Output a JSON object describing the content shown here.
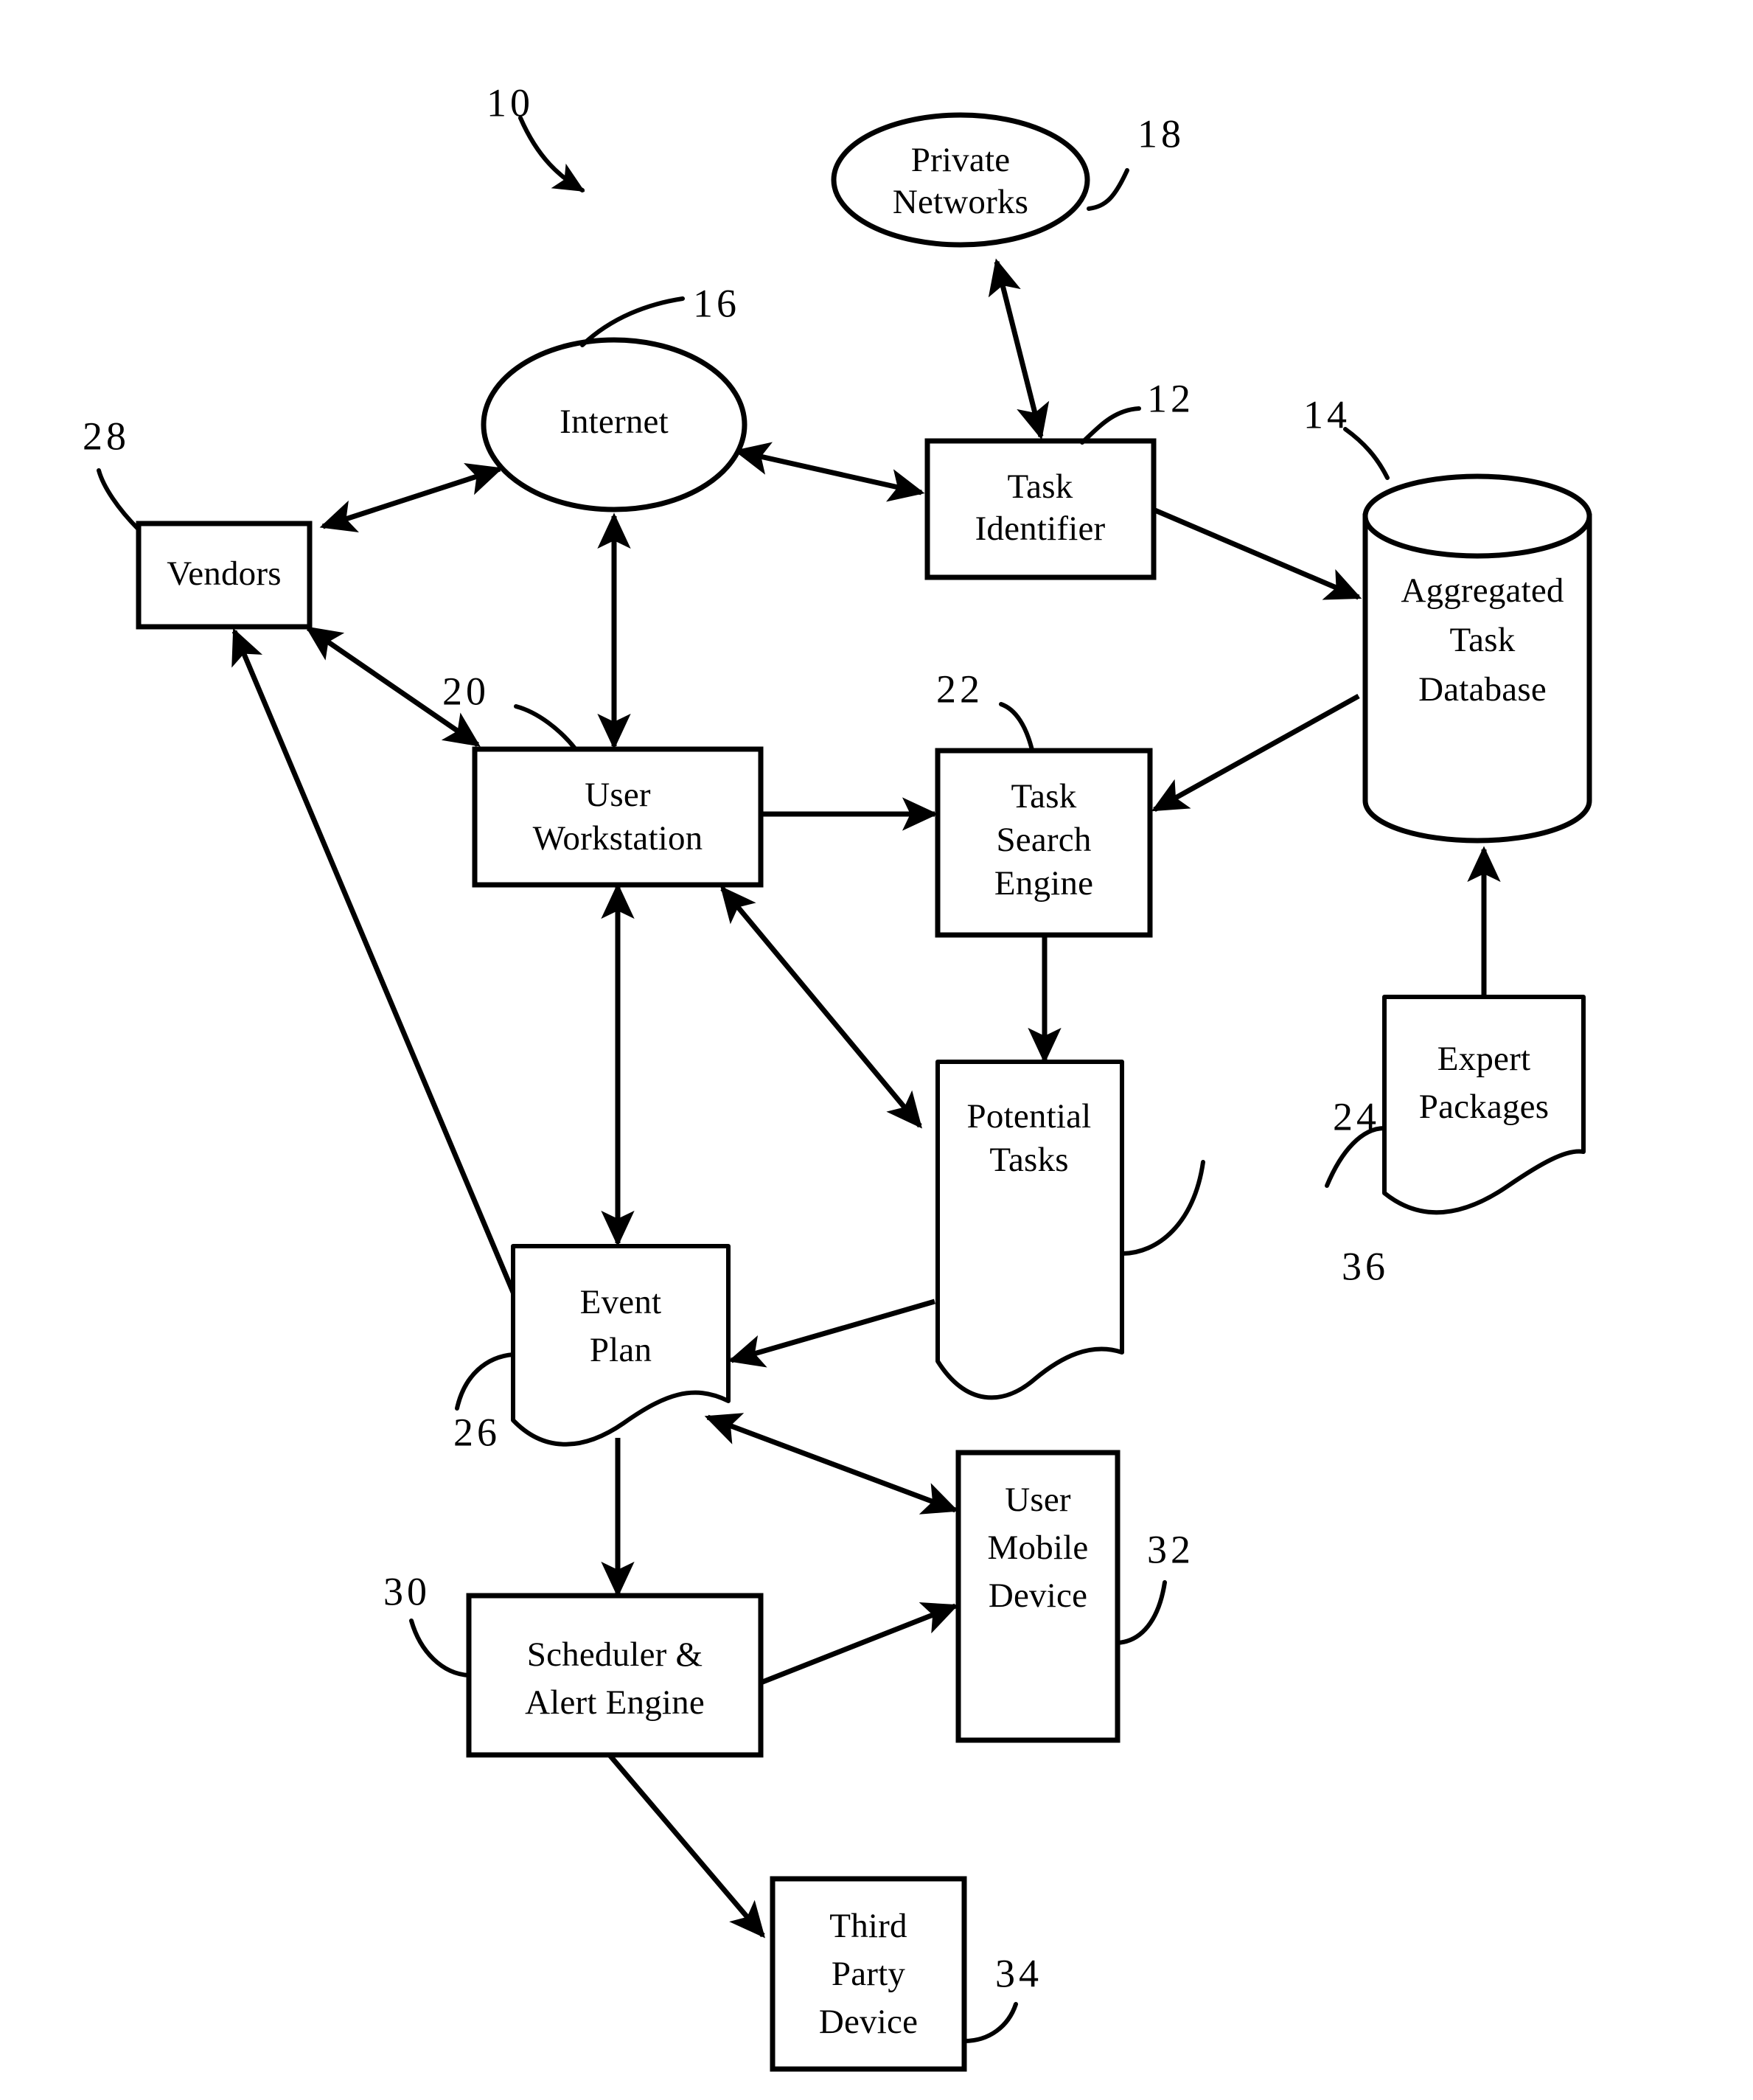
{
  "figure": {
    "type": "patent-block-diagram",
    "system_reference": "10",
    "nodes": [
      {
        "id": "private_networks",
        "label_lines": [
          "Private",
          "Networks"
        ],
        "ref": "18",
        "shape": "ellipse"
      },
      {
        "id": "internet",
        "label_lines": [
          "Internet"
        ],
        "ref": "16",
        "shape": "ellipse"
      },
      {
        "id": "task_identifier",
        "label_lines": [
          "Task",
          "Identifier"
        ],
        "ref": "12",
        "shape": "rectangle"
      },
      {
        "id": "aggregated_task_database",
        "label_lines": [
          "Aggregated",
          "Task",
          "Database"
        ],
        "ref": "14",
        "shape": "cylinder"
      },
      {
        "id": "vendors",
        "label_lines": [
          "Vendors"
        ],
        "ref": "28",
        "shape": "rectangle"
      },
      {
        "id": "user_workstation",
        "label_lines": [
          "User",
          "Workstation"
        ],
        "ref": "20",
        "shape": "rectangle"
      },
      {
        "id": "task_search_engine",
        "label_lines": [
          "Task",
          "Search",
          "Engine"
        ],
        "ref": "22",
        "shape": "rectangle"
      },
      {
        "id": "potential_tasks",
        "label_lines": [
          "Potential",
          "Tasks"
        ],
        "ref": "24",
        "shape": "document"
      },
      {
        "id": "expert_packages",
        "label_lines": [
          "Expert",
          "Packages"
        ],
        "ref": "36",
        "shape": "document"
      },
      {
        "id": "event_plan",
        "label_lines": [
          "Event",
          "Plan"
        ],
        "ref": "26",
        "shape": "document"
      },
      {
        "id": "scheduler_alert_engine",
        "label_lines": [
          "Scheduler &",
          "Alert Engine"
        ],
        "ref": "30",
        "shape": "rectangle"
      },
      {
        "id": "user_mobile_device",
        "label_lines": [
          "User",
          "Mobile",
          "Device"
        ],
        "ref": "32",
        "shape": "rectangle"
      },
      {
        "id": "third_party_device",
        "label_lines": [
          "Third",
          "Party",
          "Device"
        ],
        "ref": "34",
        "shape": "rectangle"
      }
    ],
    "edges": [
      {
        "from": "private_networks",
        "to": "task_identifier",
        "direction": "bidirectional"
      },
      {
        "from": "internet",
        "to": "task_identifier",
        "direction": "bidirectional"
      },
      {
        "from": "internet",
        "to": "vendors",
        "direction": "bidirectional"
      },
      {
        "from": "internet",
        "to": "user_workstation",
        "direction": "bidirectional"
      },
      {
        "from": "task_identifier",
        "to": "aggregated_task_database",
        "direction": "one-way"
      },
      {
        "from": "aggregated_task_database",
        "to": "task_search_engine",
        "direction": "one-way"
      },
      {
        "from": "expert_packages",
        "to": "aggregated_task_database",
        "direction": "one-way"
      },
      {
        "from": "vendors",
        "to": "user_workstation",
        "direction": "bidirectional"
      },
      {
        "from": "user_workstation",
        "to": "task_search_engine",
        "direction": "one-way"
      },
      {
        "from": "task_search_engine",
        "to": "potential_tasks",
        "direction": "one-way"
      },
      {
        "from": "potential_tasks",
        "to": "user_workstation",
        "direction": "bidirectional"
      },
      {
        "from": "potential_tasks",
        "to": "event_plan",
        "direction": "one-way"
      },
      {
        "from": "event_plan",
        "to": "user_workstation",
        "direction": "bidirectional"
      },
      {
        "from": "event_plan",
        "to": "vendors",
        "direction": "one-way"
      },
      {
        "from": "event_plan",
        "to": "scheduler_alert_engine",
        "direction": "one-way"
      },
      {
        "from": "event_plan",
        "to": "user_mobile_device",
        "direction": "bidirectional"
      },
      {
        "from": "scheduler_alert_engine",
        "to": "user_mobile_device",
        "direction": "one-way"
      },
      {
        "from": "scheduler_alert_engine",
        "to": "third_party_device",
        "direction": "one-way"
      }
    ],
    "colors": {
      "stroke": "#000000",
      "fill": "#ffffff",
      "background": "#ffffff"
    }
  },
  "labels": {
    "system_ref": "10",
    "private_networks_line1": "Private",
    "private_networks_line2": "Networks",
    "private_networks_ref": "18",
    "internet_line1": "Internet",
    "internet_ref": "16",
    "task_identifier_line1": "Task",
    "task_identifier_line2": "Identifier",
    "task_identifier_ref": "12",
    "database_line1": "Aggregated",
    "database_line2": "Task",
    "database_line3": "Database",
    "database_ref": "14",
    "vendors_line1": "Vendors",
    "vendors_ref": "28",
    "workstation_line1": "User",
    "workstation_line2": "Workstation",
    "workstation_ref": "20",
    "search_engine_line1": "Task",
    "search_engine_line2": "Search",
    "search_engine_line3": "Engine",
    "search_engine_ref": "22",
    "potential_tasks_line1": "Potential",
    "potential_tasks_line2": "Tasks",
    "potential_tasks_ref": "24",
    "expert_packages_line1": "Expert",
    "expert_packages_line2": "Packages",
    "expert_packages_ref": "36",
    "event_plan_line1": "Event",
    "event_plan_line2": "Plan",
    "event_plan_ref": "26",
    "scheduler_line1": "Scheduler &",
    "scheduler_line2": "Alert Engine",
    "scheduler_ref": "30",
    "mobile_line1": "User",
    "mobile_line2": "Mobile",
    "mobile_line3": "Device",
    "mobile_ref": "32",
    "third_party_line1": "Third",
    "third_party_line2": "Party",
    "third_party_line3": "Device",
    "third_party_ref": "34"
  }
}
